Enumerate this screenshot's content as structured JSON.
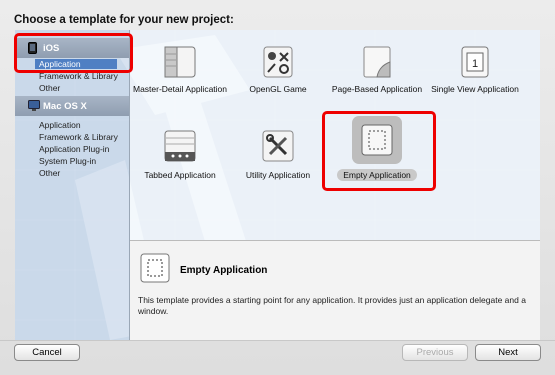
{
  "dialog": {
    "title": "Choose a template for your new project:"
  },
  "sidebar": {
    "categories": [
      {
        "label": "iOS",
        "icon": "iphone-icon",
        "items": [
          {
            "label": "Application",
            "selected": true
          },
          {
            "label": "Framework & Library"
          },
          {
            "label": "Other"
          }
        ]
      },
      {
        "label": "Mac OS X",
        "icon": "mac-display-icon",
        "items": [
          {
            "label": "Application"
          },
          {
            "label": "Framework & Library"
          },
          {
            "label": "Application Plug-in"
          },
          {
            "label": "System Plug-in"
          },
          {
            "label": "Other"
          }
        ]
      }
    ]
  },
  "templates": [
    {
      "label": "Master-Detail Application",
      "icon": "master-detail-icon"
    },
    {
      "label": "OpenGL Game",
      "icon": "opengl-game-icon"
    },
    {
      "label": "Page-Based Application",
      "icon": "page-curl-icon"
    },
    {
      "label": "Single View Application",
      "icon": "single-view-icon",
      "glyph": "1"
    },
    {
      "label": "Tabbed Application",
      "icon": "tabbed-icon"
    },
    {
      "label": "Utility Application",
      "icon": "utility-tools-icon"
    },
    {
      "label": "Empty Application",
      "icon": "empty-app-icon",
      "selected": true
    }
  ],
  "detail": {
    "title": "Empty Application",
    "description": "This template provides a starting point for any application. It provides just an application delegate and a window."
  },
  "buttons": {
    "cancel": "Cancel",
    "previous": "Previous",
    "next": "Next"
  },
  "colors": {
    "highlight_border": "#e00000",
    "selection_blue": "#4f7fc3"
  }
}
